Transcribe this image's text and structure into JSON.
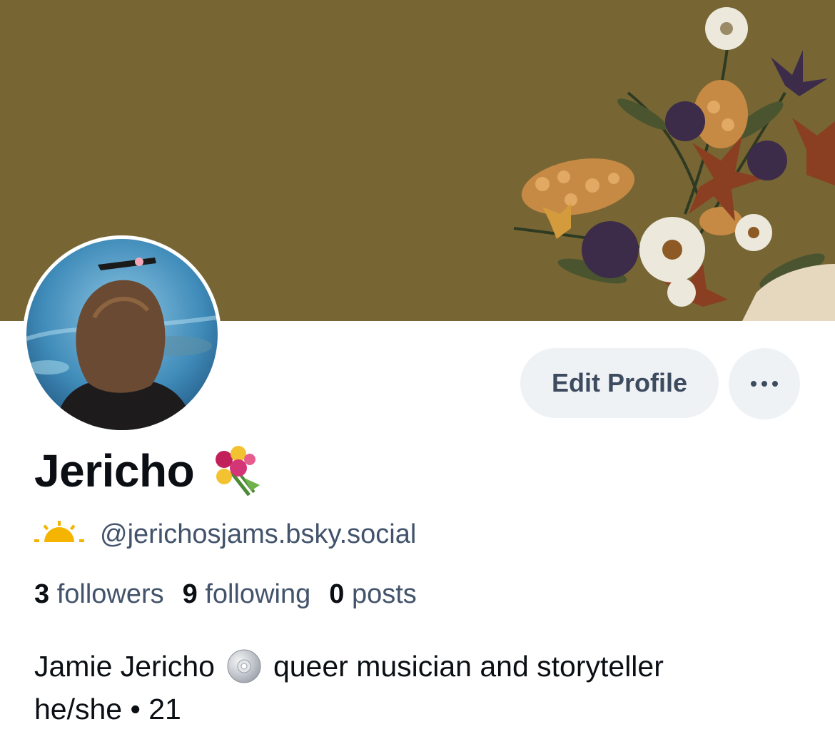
{
  "profile": {
    "display_name": "Jericho",
    "name_emoji": "bouquet-emoji",
    "handle_emoji": "sunrise-emoji",
    "handle": "@jerichosjams.bsky.social",
    "stats": [
      {
        "count": "3",
        "label": "followers"
      },
      {
        "count": "9",
        "label": "following"
      },
      {
        "count": "0",
        "label": "posts"
      }
    ],
    "bio": {
      "line1_before": "Jamie Jericho",
      "line1_emoji": "disc-emoji",
      "line1_after": "queer musician and storyteller",
      "line2": "he/she • 21"
    }
  },
  "actions": {
    "edit_label": "Edit Profile",
    "more_icon": "ellipsis-icon"
  },
  "colors": {
    "banner": "#776634",
    "button_bg": "#eff2f5",
    "button_text": "#3d4b5f",
    "secondary_text": "#42536b",
    "primary_text": "#0b0f14"
  }
}
